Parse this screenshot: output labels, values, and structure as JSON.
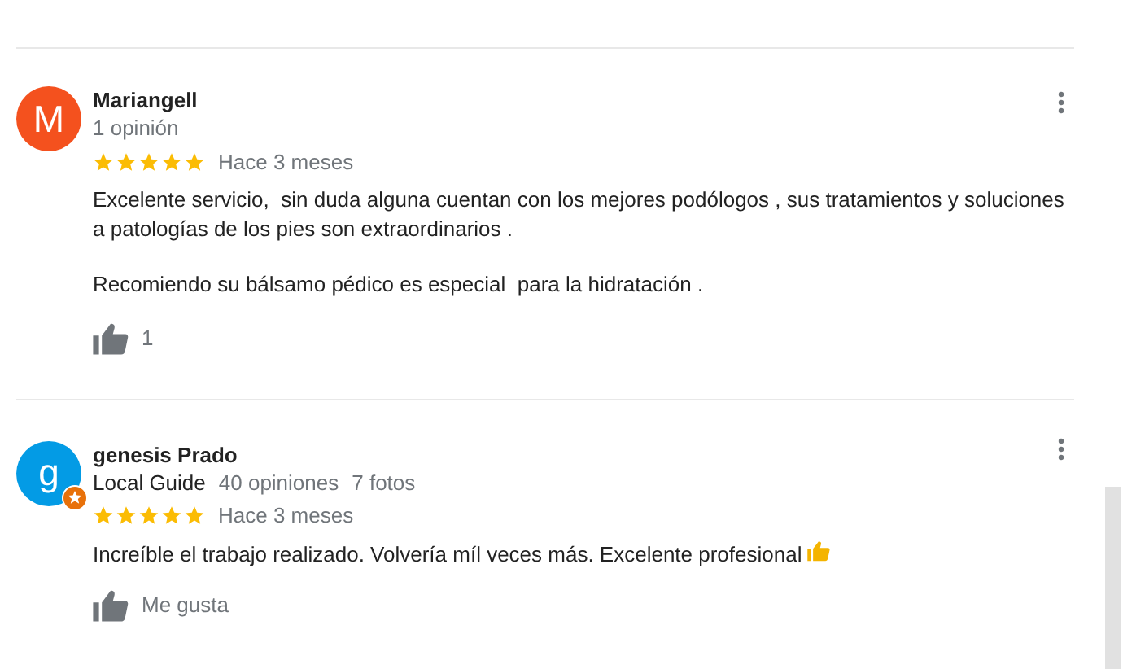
{
  "reviews": [
    {
      "avatar": {
        "letter": "M",
        "color": "#f4511e"
      },
      "name": "Mariangell",
      "meta": [
        "1 opinión"
      ],
      "stars": 5,
      "time": "Hace 3 meses",
      "paragraphs": [
        "Excelente servicio,  sin duda alguna cuentan con los mejores podólogos , sus tratamientos y soluciones a patologías de los pies son extraordinarios .",
        "Recomiendo su bálsamo pédico es especial  para la hidratación ."
      ],
      "like_label": "1"
    },
    {
      "avatar": {
        "letter": "g",
        "color": "#039be5",
        "local_guide": true
      },
      "name": "genesis Prado",
      "badge": "Local Guide",
      "meta": [
        "40 opiniones",
        "7 fotos"
      ],
      "stars": 5,
      "time": "Hace 3 meses",
      "paragraphs": [
        "Increíble el trabajo realizado. Volvería míl veces más. Excelente profesional"
      ],
      "ends_with_thumb_emoji": true,
      "like_label": "Me gusta"
    }
  ]
}
